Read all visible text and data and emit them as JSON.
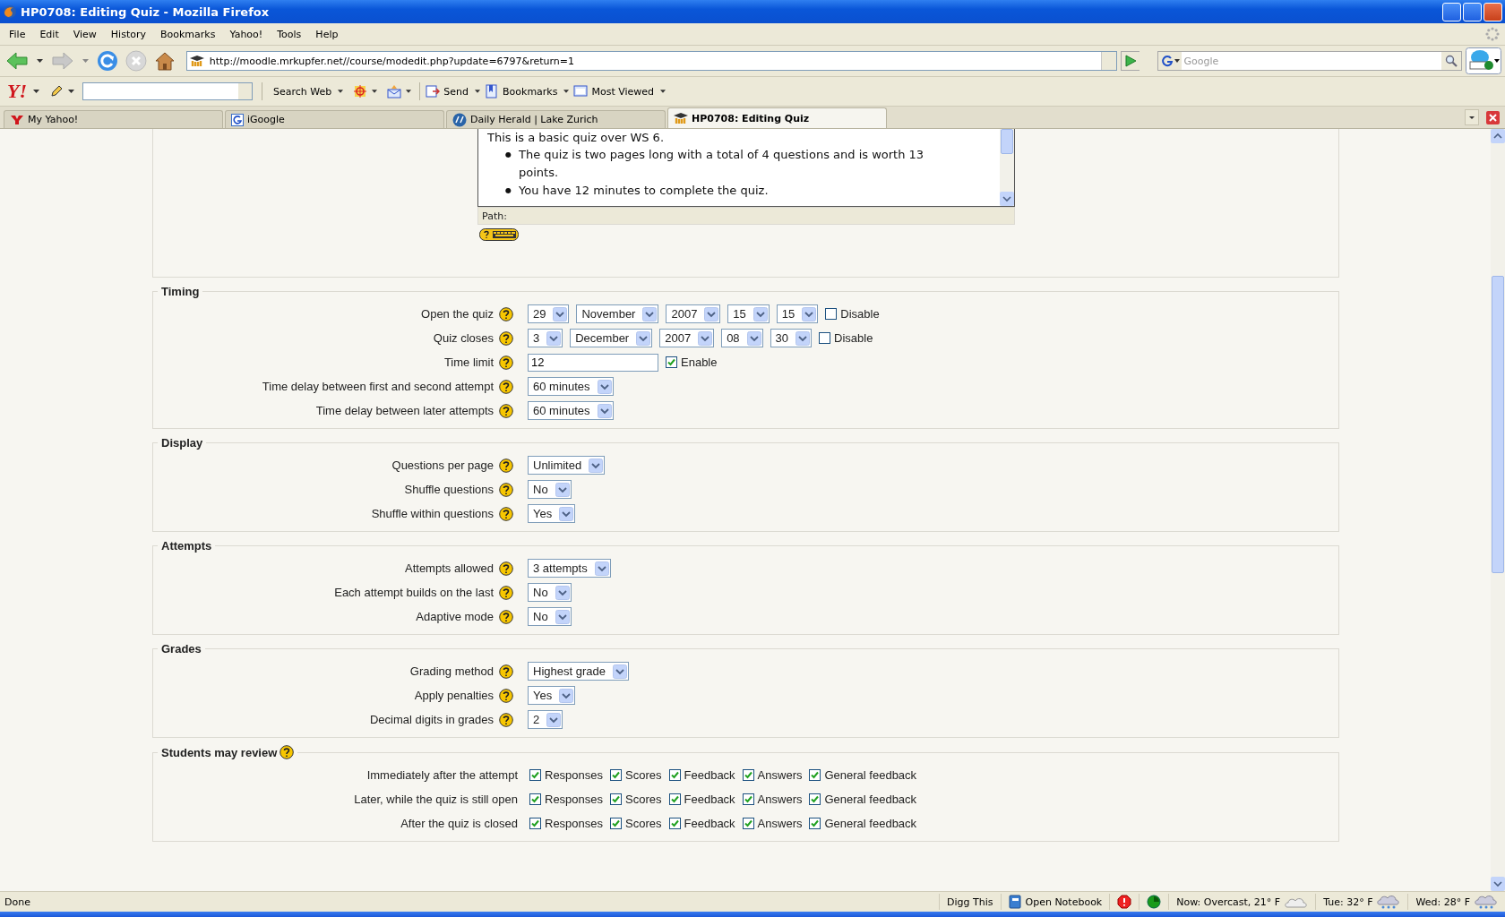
{
  "window": {
    "title": "HP0708: Editing Quiz - Mozilla Firefox"
  },
  "menu": [
    "File",
    "Edit",
    "View",
    "History",
    "Bookmarks",
    "Yahoo!",
    "Tools",
    "Help"
  ],
  "navigation": {
    "url": "http://moodle.mrkupfer.net//course/modedit.php?update=6797&return=1",
    "search_placeholder": "Google"
  },
  "yahoo_toolbar": {
    "logo": "Y!",
    "items": [
      {
        "label": "Search Web"
      },
      {
        "label": "Send"
      },
      {
        "label": "Bookmarks"
      },
      {
        "label": "Most Viewed"
      }
    ]
  },
  "tabs": [
    {
      "label": "My Yahoo!",
      "selected": false
    },
    {
      "label": "iGoogle",
      "selected": false
    },
    {
      "label": "Daily Herald | Lake Zurich",
      "selected": false
    },
    {
      "label": "HP0708: Editing Quiz",
      "selected": true
    }
  ],
  "editor": {
    "intro": "This is a basic quiz over WS 6.",
    "marker": "●",
    "bullets": [
      "The quiz is two pages long with a total of 4 questions and is worth 13 points.",
      "You have 12 minutes to complete the quiz."
    ],
    "path_label": "Path:"
  },
  "sections": [
    {
      "title": "Timing",
      "help": false,
      "rows": [
        {
          "label": "Open the quiz",
          "help": true,
          "controls": [
            {
              "kind": "select",
              "value": "29"
            },
            {
              "kind": "select",
              "value": "November"
            },
            {
              "kind": "select",
              "value": "2007"
            },
            {
              "kind": "select",
              "value": "15"
            },
            {
              "kind": "select",
              "value": "15"
            },
            {
              "kind": "checkbox",
              "label": "Disable",
              "checked": false
            }
          ]
        },
        {
          "label": "Quiz closes",
          "help": true,
          "controls": [
            {
              "kind": "select",
              "value": "3"
            },
            {
              "kind": "select",
              "value": "December"
            },
            {
              "kind": "select",
              "value": "2007"
            },
            {
              "kind": "select",
              "value": "08"
            },
            {
              "kind": "select",
              "value": "30"
            },
            {
              "kind": "checkbox",
              "label": "Disable",
              "checked": false
            }
          ]
        },
        {
          "label": "Time limit",
          "help": true,
          "controls": [
            {
              "kind": "text",
              "value": "12"
            },
            {
              "kind": "checkbox",
              "label": "Enable",
              "checked": true
            }
          ]
        },
        {
          "label": "Time delay between first and second attempt",
          "help": true,
          "controls": [
            {
              "kind": "select",
              "value": "60 minutes"
            }
          ]
        },
        {
          "label": "Time delay between later attempts",
          "help": true,
          "controls": [
            {
              "kind": "select",
              "value": "60 minutes"
            }
          ]
        }
      ]
    },
    {
      "title": "Display",
      "help": false,
      "rows": [
        {
          "label": "Questions per page",
          "help": true,
          "controls": [
            {
              "kind": "select",
              "value": "Unlimited"
            }
          ]
        },
        {
          "label": "Shuffle questions",
          "help": true,
          "controls": [
            {
              "kind": "select",
              "value": "No"
            }
          ]
        },
        {
          "label": "Shuffle within questions",
          "help": true,
          "controls": [
            {
              "kind": "select",
              "value": "Yes"
            }
          ]
        }
      ]
    },
    {
      "title": "Attempts",
      "help": false,
      "rows": [
        {
          "label": "Attempts allowed",
          "help": true,
          "controls": [
            {
              "kind": "select",
              "value": "3 attempts"
            }
          ]
        },
        {
          "label": "Each attempt builds on the last",
          "help": true,
          "controls": [
            {
              "kind": "select",
              "value": "No"
            }
          ]
        },
        {
          "label": "Adaptive mode",
          "help": true,
          "controls": [
            {
              "kind": "select",
              "value": "No"
            }
          ]
        }
      ]
    },
    {
      "title": "Grades",
      "help": false,
      "rows": [
        {
          "label": "Grading method",
          "help": true,
          "controls": [
            {
              "kind": "select",
              "value": "Highest grade"
            }
          ]
        },
        {
          "label": "Apply penalties",
          "help": true,
          "controls": [
            {
              "kind": "select",
              "value": "Yes"
            }
          ]
        },
        {
          "label": "Decimal digits in grades",
          "help": true,
          "controls": [
            {
              "kind": "select",
              "value": "2"
            }
          ]
        }
      ]
    },
    {
      "title": "Students may review",
      "help": true,
      "rows": [
        {
          "label": "Immediately after the attempt",
          "help": false,
          "controls": [
            {
              "kind": "checkbox",
              "label": "Responses",
              "checked": true
            },
            {
              "kind": "checkbox",
              "label": "Scores",
              "checked": true
            },
            {
              "kind": "checkbox",
              "label": "Feedback",
              "checked": true
            },
            {
              "kind": "checkbox",
              "label": "Answers",
              "checked": true
            },
            {
              "kind": "checkbox",
              "label": "General feedback",
              "checked": true
            }
          ]
        },
        {
          "label": "Later, while the quiz is still open",
          "help": false,
          "controls": [
            {
              "kind": "checkbox",
              "label": "Responses",
              "checked": true
            },
            {
              "kind": "checkbox",
              "label": "Scores",
              "checked": true
            },
            {
              "kind": "checkbox",
              "label": "Feedback",
              "checked": true
            },
            {
              "kind": "checkbox",
              "label": "Answers",
              "checked": true
            },
            {
              "kind": "checkbox",
              "label": "General feedback",
              "checked": true
            }
          ]
        },
        {
          "label": "After the quiz is closed",
          "help": false,
          "controls": [
            {
              "kind": "checkbox",
              "label": "Responses",
              "checked": true
            },
            {
              "kind": "checkbox",
              "label": "Scores",
              "checked": true
            },
            {
              "kind": "checkbox",
              "label": "Feedback",
              "checked": true
            },
            {
              "kind": "checkbox",
              "label": "Answers",
              "checked": true
            },
            {
              "kind": "checkbox",
              "label": "General feedback",
              "checked": true
            }
          ]
        }
      ]
    }
  ],
  "status_bar": {
    "text": "Done",
    "items": [
      {
        "kind": "text",
        "label": "Digg This"
      },
      {
        "kind": "notebook",
        "label": "Open Notebook"
      },
      {
        "kind": "alert"
      },
      {
        "kind": "online"
      },
      {
        "kind": "weather",
        "label": "Now: Overcast, 21° F"
      },
      {
        "kind": "weather",
        "label": "Tue: 32° F"
      },
      {
        "kind": "weather",
        "label": "Wed: 28° F"
      }
    ]
  }
}
